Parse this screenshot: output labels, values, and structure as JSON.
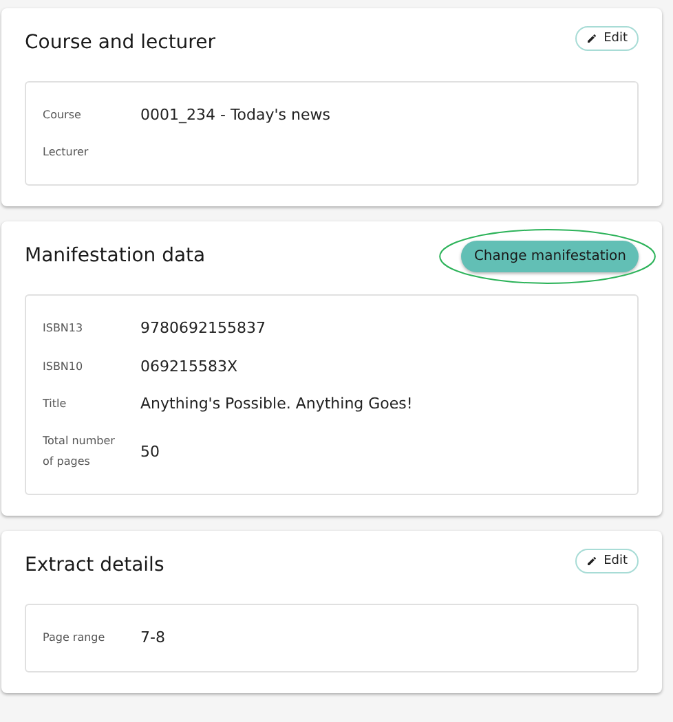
{
  "sections": [
    {
      "title": "Course and lecturer",
      "action": {
        "kind": "edit",
        "label": "Edit"
      },
      "rows": [
        {
          "label": "Course",
          "value": "0001_234 - Today's news"
        },
        {
          "label": "Lecturer"
        }
      ]
    },
    {
      "title": "Manifestation data",
      "action": {
        "kind": "primary",
        "label": "Change manifestation",
        "circled": true
      },
      "rows": [
        {
          "label": "ISBN13",
          "value": "9780692155837"
        },
        {
          "label": "ISBN10",
          "value": "069215583X"
        },
        {
          "label": "Title",
          "value": "Anything's Possible. Anything Goes!"
        },
        {
          "label": "Total number of pages",
          "value": "50"
        }
      ]
    },
    {
      "title": "Extract details",
      "action": {
        "kind": "edit",
        "label": "Edit"
      },
      "rows": [
        {
          "label": "Page range",
          "value": "7-8"
        }
      ]
    }
  ]
}
